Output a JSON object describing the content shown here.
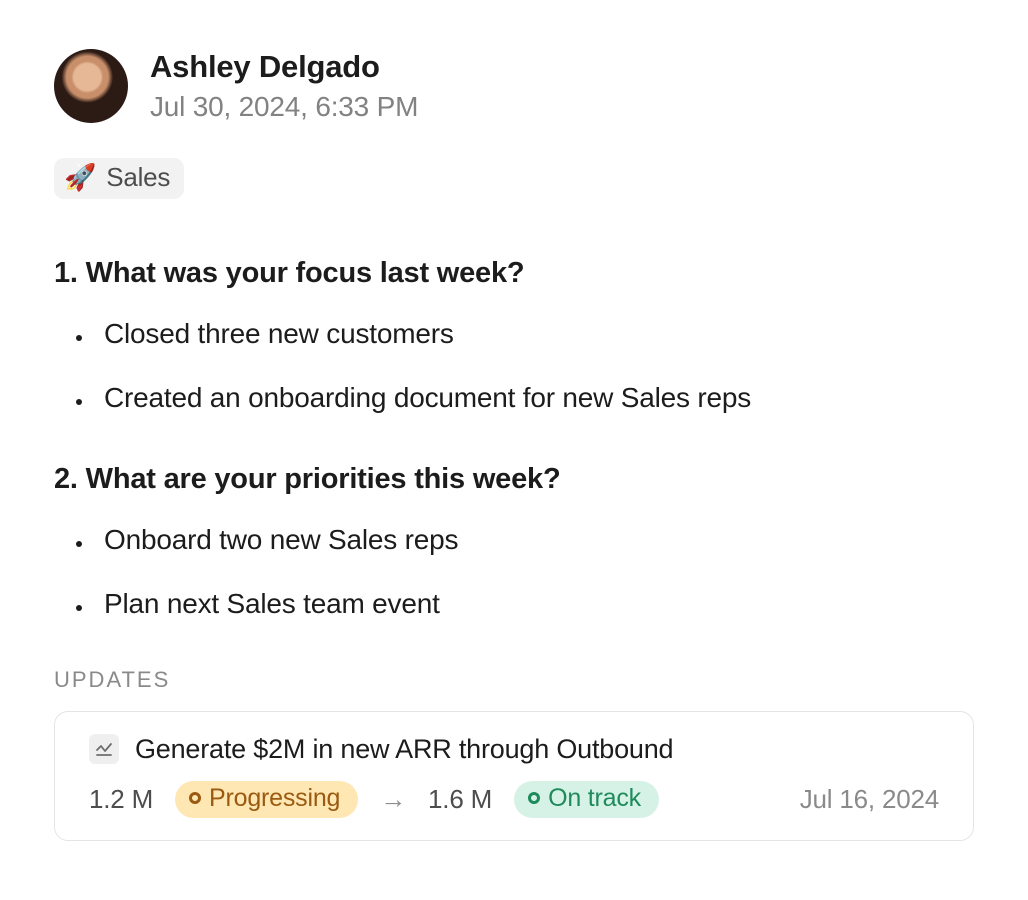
{
  "author": {
    "name": "Ashley Delgado",
    "timestamp": "Jul 30, 2024, 6:33 PM"
  },
  "tag": {
    "emoji": "🚀",
    "label": "Sales"
  },
  "sections": [
    {
      "title": "1. What was your focus last week?",
      "items": [
        "Closed three new customers",
        "Created an onboarding document for new Sales reps"
      ]
    },
    {
      "title": "2. What are your priorities this week?",
      "items": [
        "Onboard two new Sales reps",
        "Plan next Sales team event"
      ]
    }
  ],
  "updates": {
    "label": "UPDATES",
    "card": {
      "title": "Generate $2M in new ARR through Outbound",
      "from_value": "1.2 M",
      "from_status": "Progressing",
      "to_value": "1.6 M",
      "to_status": "On track",
      "arrow": "→",
      "date": "Jul 16, 2024"
    }
  },
  "colors": {
    "text": "#1d1c1d",
    "muted": "#828282",
    "tag_bg": "#f2f2f2",
    "card_border": "#e4e4e4",
    "progressing_bg": "#ffe7b3",
    "progressing_fg": "#9a5a12",
    "ontrack_bg": "#d6f2e6",
    "ontrack_fg": "#1f8a5b"
  }
}
